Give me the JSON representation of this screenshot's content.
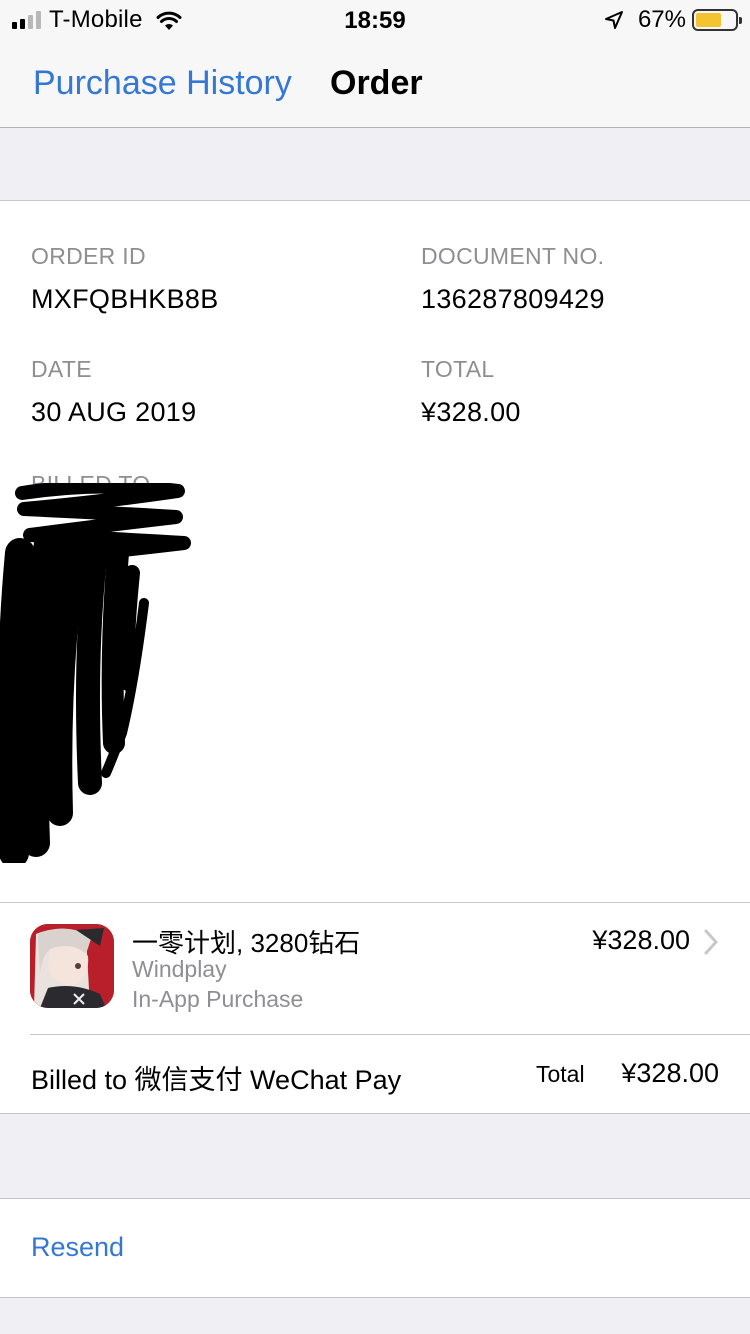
{
  "status_bar": {
    "carrier": "T-Mobile",
    "time": "18:59",
    "battery_percent": "67%",
    "battery_level": 0.67,
    "signal_bars_filled": 2,
    "signal_bars_total": 4,
    "icons": [
      "signal-icon",
      "wifi-icon",
      "location-icon",
      "battery-icon"
    ]
  },
  "nav": {
    "back_label": "Purchase History",
    "title": "Order"
  },
  "order": {
    "order_id_label": "ORDER ID",
    "order_id": "MXFQBHKB8B",
    "document_no_label": "DOCUMENT NO.",
    "document_no": "136287809429",
    "date_label": "DATE",
    "date": "30 AUG 2019",
    "total_label": "TOTAL",
    "total": "¥328.00",
    "billed_to_label": "BILLED TO"
  },
  "item": {
    "title": "一零计划, 3280钻石",
    "developer": "Windplay",
    "type": "In-App Purchase",
    "price": "¥328.00",
    "icon": "app-icon"
  },
  "billing": {
    "billed_to": "Billed to 微信支付 WeChat Pay",
    "total_label": "Total",
    "total_value": "¥328.00"
  },
  "actions": {
    "resend_label": "Resend"
  },
  "colors": {
    "accent": "#3478d4",
    "background": "#efeff4",
    "secondary_text": "#8e8e93",
    "app_icon": "#c0262d",
    "battery": "#f4c430"
  }
}
